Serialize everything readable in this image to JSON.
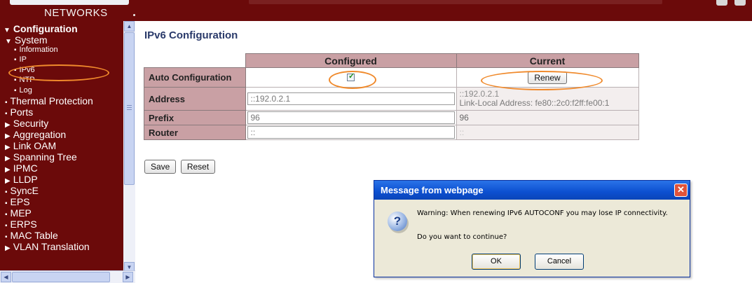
{
  "header": {
    "brand_line": "NETWORKS"
  },
  "nav": [
    {
      "label": "Configuration",
      "level": 0,
      "marker": "▼"
    },
    {
      "label": "System",
      "level": 1,
      "marker": "▼"
    },
    {
      "label": "Information",
      "level": 2,
      "marker": "▪"
    },
    {
      "label": "IP",
      "level": 2,
      "marker": "▪"
    },
    {
      "label": "IPv6",
      "level": 2,
      "marker": "▪",
      "selected": true
    },
    {
      "label": "NTP",
      "level": 2,
      "marker": "▪"
    },
    {
      "label": "Log",
      "level": 2,
      "marker": "▪"
    },
    {
      "label": "Thermal Protection",
      "level": 1,
      "marker": "▪"
    },
    {
      "label": "Ports",
      "level": 1,
      "marker": "▪"
    },
    {
      "label": "Security",
      "level": 1,
      "marker": "▶"
    },
    {
      "label": "Aggregation",
      "level": 1,
      "marker": "▶"
    },
    {
      "label": "Link OAM",
      "level": 1,
      "marker": "▶"
    },
    {
      "label": "Spanning Tree",
      "level": 1,
      "marker": "▶"
    },
    {
      "label": "IPMC",
      "level": 1,
      "marker": "▶"
    },
    {
      "label": "LLDP",
      "level": 1,
      "marker": "▶"
    },
    {
      "label": "SyncE",
      "level": 1,
      "marker": "▪"
    },
    {
      "label": "EPS",
      "level": 1,
      "marker": "▪"
    },
    {
      "label": "MEP",
      "level": 1,
      "marker": "▪"
    },
    {
      "label": "ERPS",
      "level": 1,
      "marker": "▪"
    },
    {
      "label": "MAC Table",
      "level": 1,
      "marker": "▪"
    },
    {
      "label": "VLAN Translation",
      "level": 1,
      "marker": "▶"
    }
  ],
  "page": {
    "title": "IPv6 Configuration",
    "columns": {
      "configured": "Configured",
      "current": "Current"
    },
    "rows": {
      "auto_config": {
        "label": "Auto Configuration",
        "checked": true,
        "renew_label": "Renew"
      },
      "address": {
        "label": "Address",
        "value": "::192.0.2.1",
        "current_line1": "::192.0.2.1",
        "current_line2": "Link-Local Address: fe80::2c0:f2ff:fe00:1"
      },
      "prefix": {
        "label": "Prefix",
        "value": "96",
        "current": "96"
      },
      "router": {
        "label": "Router",
        "value": "::",
        "current": "::"
      }
    },
    "save_label": "Save",
    "reset_label": "Reset"
  },
  "dialog": {
    "title": "Message from webpage",
    "close_glyph": "✕",
    "icon_glyph": "?",
    "message_line1": "Warning: When renewing IPv6 AUTOCONF you may lose IP connectivity.",
    "message_line2": "Do you want to continue?",
    "ok_label": "OK",
    "cancel_label": "Cancel"
  },
  "colors": {
    "nav_background": "#6b0a0a",
    "table_header": "#c9a0a4",
    "annotation_ring": "#f08a2c",
    "dialog_titlebar": "#0c4fd0"
  }
}
